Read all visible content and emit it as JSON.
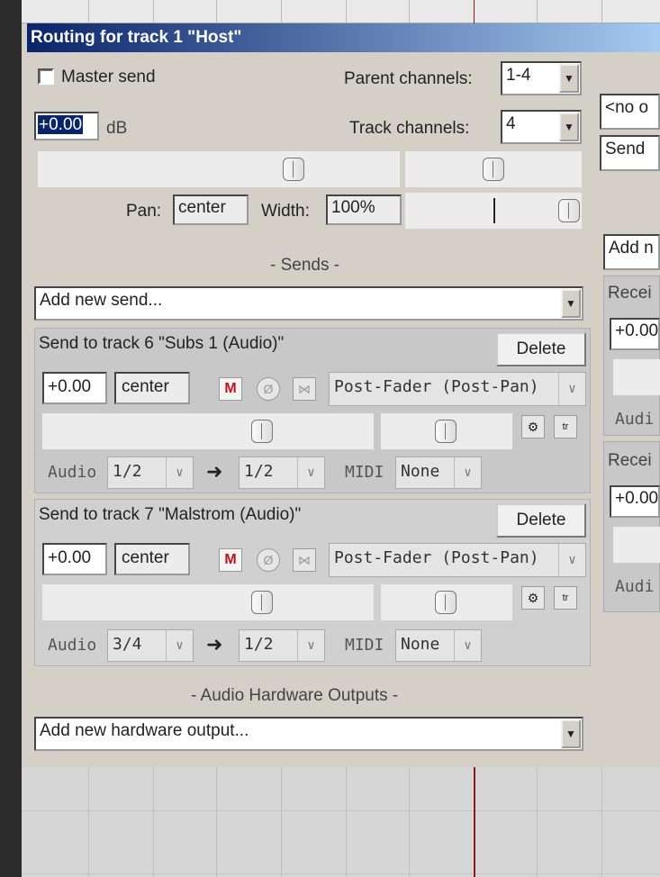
{
  "window": {
    "title": "Routing for track 1 \"Host\""
  },
  "master": {
    "master_send_label": "Master send",
    "volume_value": "+0.00",
    "db_label": "dB",
    "pan_label": "Pan:",
    "pan_value": "center",
    "width_label": "Width:",
    "width_value": "100%"
  },
  "channels": {
    "parent_label": "Parent channels:",
    "parent_value": "1-4",
    "track_label": "Track channels:",
    "track_value": "4"
  },
  "sends": {
    "header": "- Sends -",
    "add_new": "Add new send...",
    "items": [
      {
        "title": "Send to track 6 \"Subs 1 (Audio)\"",
        "delete": "Delete",
        "volume": "+0.00",
        "pan": "center",
        "mute": "M",
        "phase": "Ø",
        "mode": "Post-Fader (Post-Pan)",
        "audio_label": "Audio",
        "audio_src": "1/2",
        "arrow": "➜",
        "audio_dst": "1/2",
        "midi_label": "MIDI",
        "midi_value": "None"
      },
      {
        "title": "Send to track 7 \"Malstrom (Audio)\"",
        "delete": "Delete",
        "volume": "+0.00",
        "pan": "center",
        "mute": "M",
        "phase": "Ø",
        "mode": "Post-Fader (Post-Pan)",
        "audio_label": "Audio",
        "audio_src": "3/4",
        "arrow": "➜",
        "audio_dst": "1/2",
        "midi_label": "MIDI",
        "midi_value": "None"
      }
    ]
  },
  "hardware": {
    "header": "- Audio Hardware Outputs -",
    "add_new": "Add new hardware output..."
  },
  "right": {
    "combo1": "<no o",
    "combo2": "Send",
    "add_receive": "Add n",
    "receive_label_1": "Recei",
    "receive_vol_1": "+0.00",
    "audio_label_1": "Audi",
    "receive_label_2": "Recei",
    "receive_vol_2": "+0.00",
    "audio_label_2": "Audi"
  },
  "icons": {
    "dropdown": "▼",
    "chevron": "∨",
    "phase": "Ø",
    "link": "⋈",
    "env": "⚙",
    "trim": "tr"
  }
}
